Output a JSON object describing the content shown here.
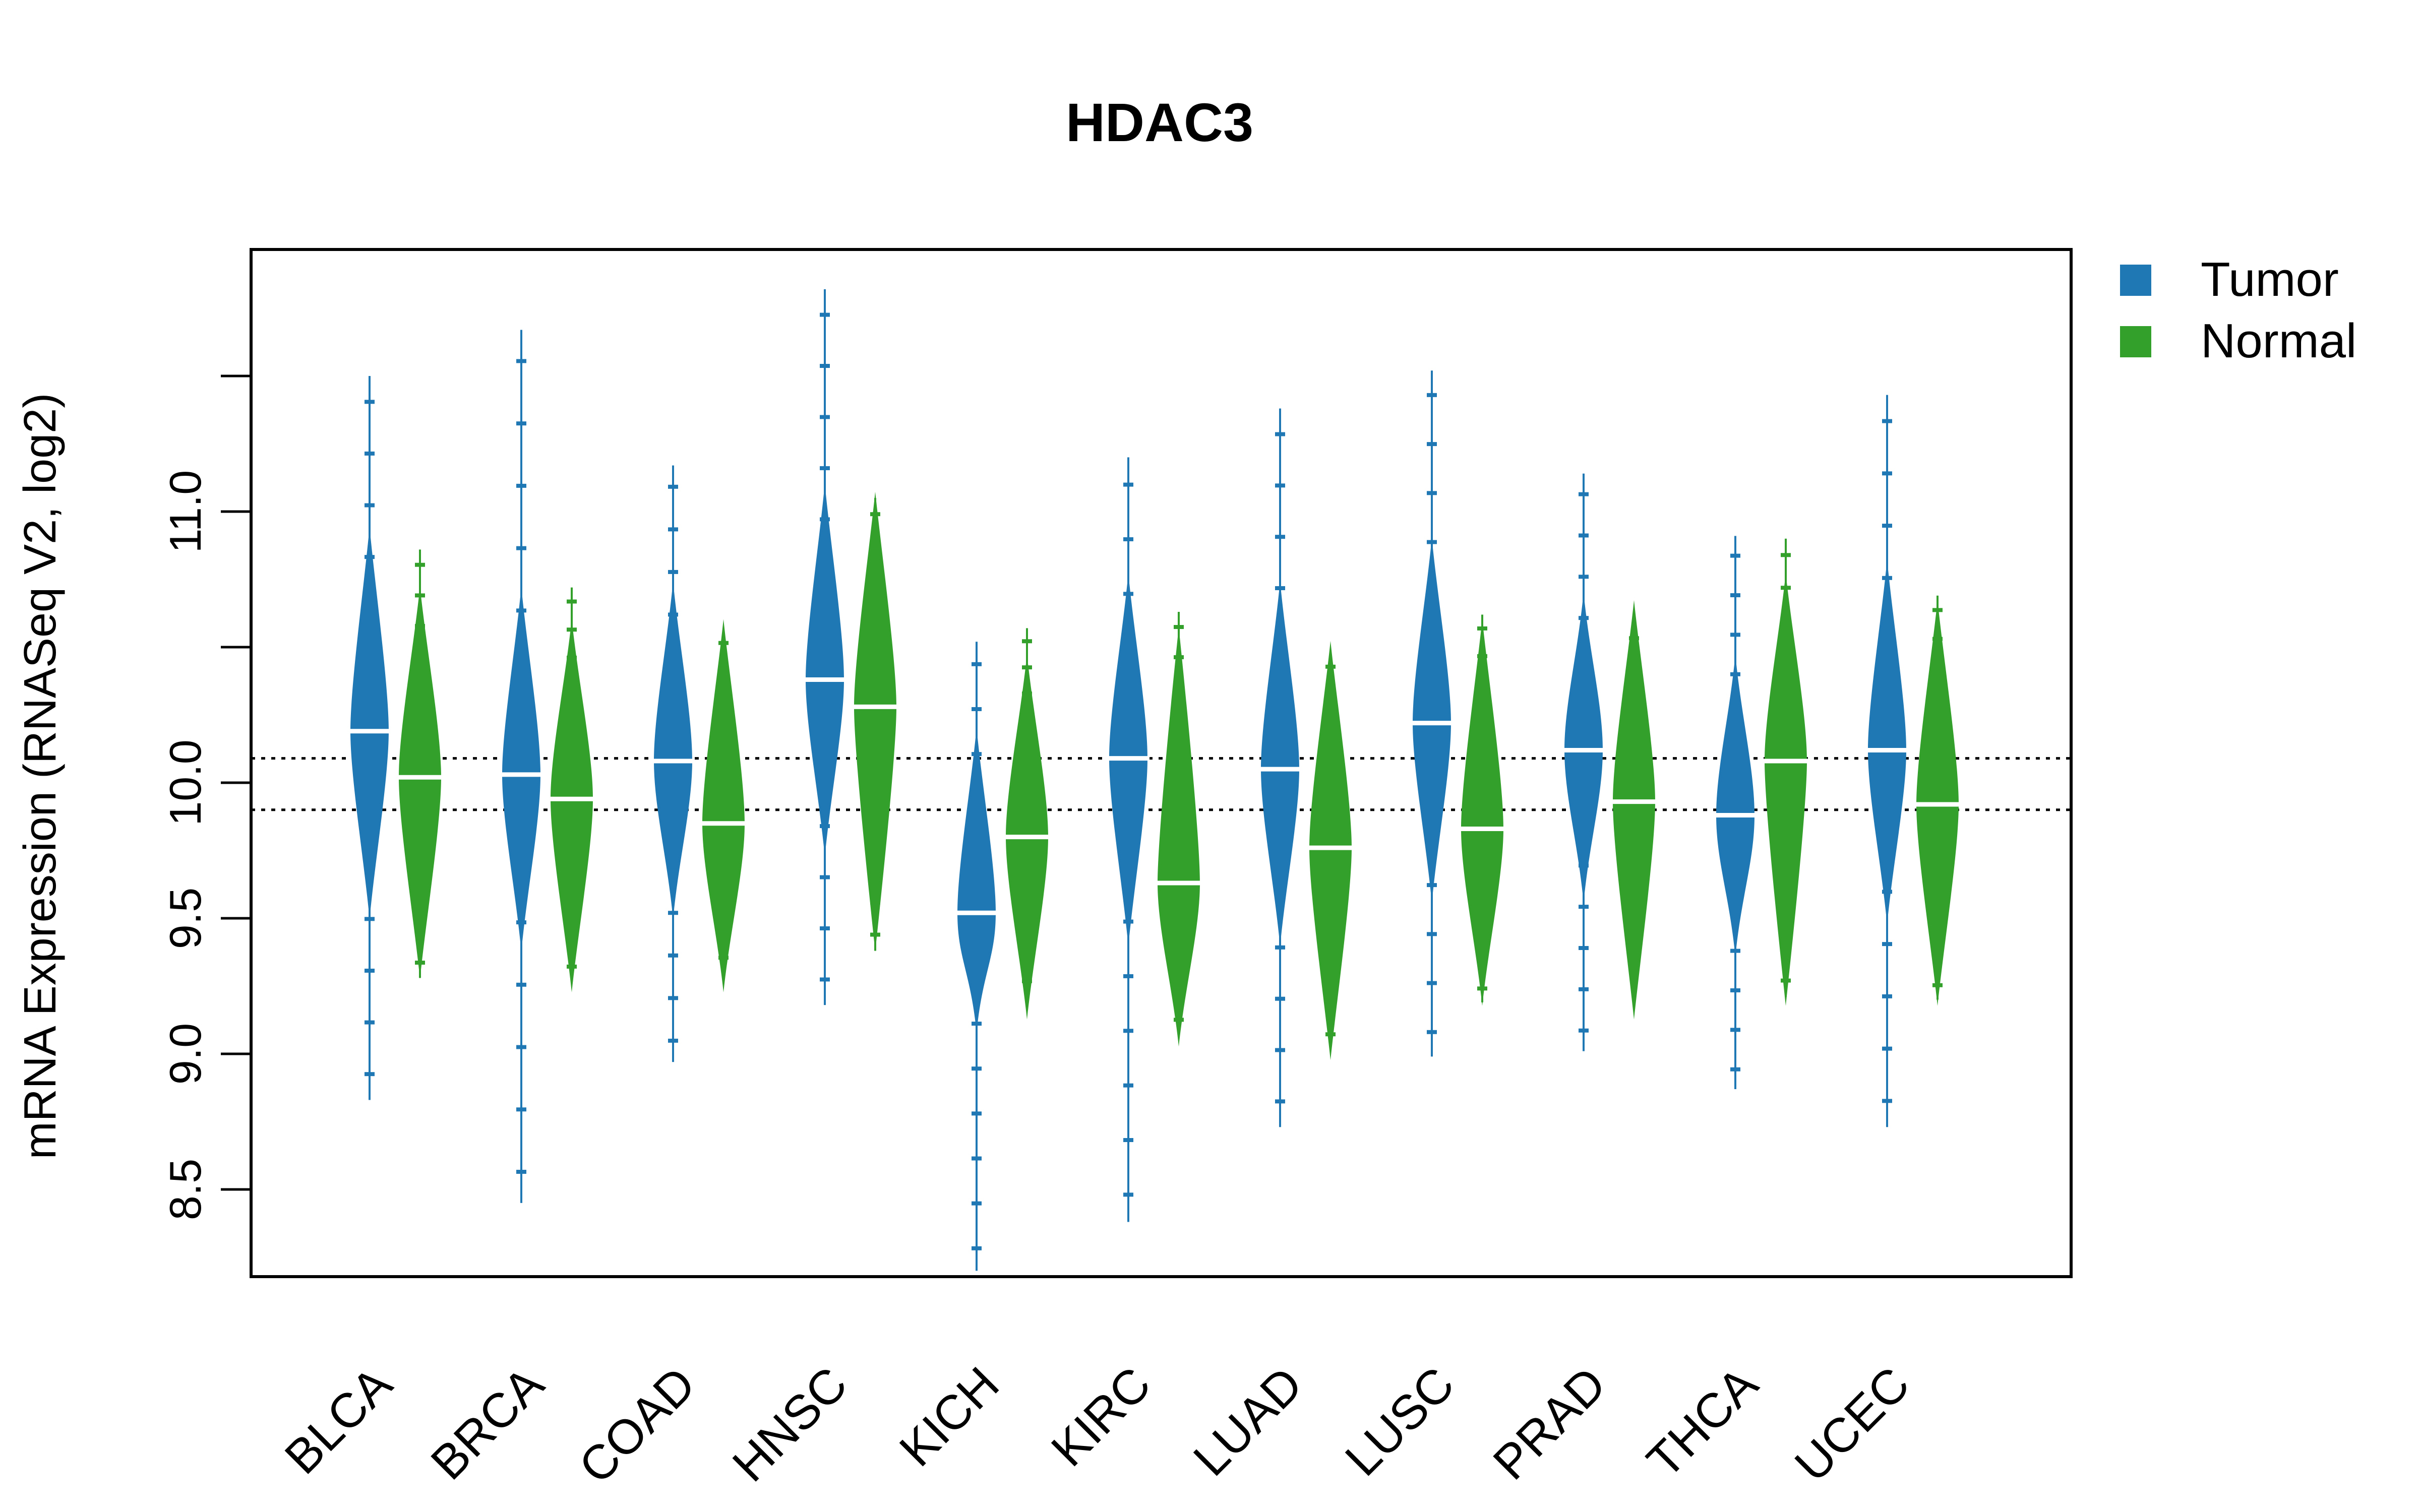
{
  "chart_data": {
    "type": "violin",
    "title": "HDAC3",
    "xlabel": "",
    "ylabel": "mRNA Expression (RNASeq V2, log2)",
    "ylim": [
      8.18,
      11.97
    ],
    "yticks": [
      8.5,
      9.0,
      9.5,
      10.0,
      10.5,
      11.0,
      11.5
    ],
    "ytick_labels": [
      "8.5",
      "9.0",
      "9.5",
      "10.0",
      "",
      "11.0",
      ""
    ],
    "hlines": [
      10.09,
      9.9
    ],
    "hline_style": "dotted",
    "legend": {
      "position": "top-right-outside",
      "entries": [
        {
          "name": "Tumor",
          "color": "#1f78b4"
        },
        {
          "name": "Normal",
          "color": "#33a02c"
        }
      ]
    },
    "categories": [
      "BLCA",
      "BRCA",
      "COAD",
      "HNSC",
      "KICH",
      "KIRC",
      "LUAD",
      "LUSC",
      "PRAD",
      "THCA",
      "UCEC"
    ],
    "series": [
      {
        "name": "Tumor",
        "color": "#1f78b4",
        "median": [
          10.19,
          10.03,
          10.08,
          10.38,
          9.52,
          10.09,
          10.05,
          10.22,
          10.12,
          9.88,
          10.12
        ],
        "min": [
          8.83,
          8.45,
          8.97,
          9.18,
          8.2,
          8.38,
          8.73,
          8.99,
          9.01,
          8.87,
          8.73
        ],
        "max": [
          11.5,
          11.67,
          11.17,
          11.82,
          10.52,
          11.2,
          11.38,
          11.52,
          11.14,
          10.91,
          11.43
        ],
        "q_low": [
          9.72,
          9.6,
          9.72,
          9.95,
          9.3,
          9.62,
          9.62,
          9.78,
          9.78,
          9.58,
          9.7
        ],
        "q_high": [
          10.72,
          10.5,
          10.52,
          10.88,
          9.98,
          10.55,
          10.52,
          10.68,
          10.48,
          10.25,
          10.6
        ]
      },
      {
        "name": "Normal",
        "color": "#33a02c",
        "median": [
          10.02,
          9.94,
          9.85,
          10.28,
          9.8,
          9.63,
          9.76,
          9.83,
          9.93,
          10.08,
          9.92
        ],
        "min": [
          9.28,
          9.27,
          9.31,
          9.38,
          9.22,
          9.07,
          9.02,
          9.19,
          9.26,
          9.21,
          9.2
        ],
        "max": [
          10.86,
          10.72,
          10.56,
          11.05,
          10.57,
          10.63,
          10.48,
          10.62,
          10.58,
          10.9,
          10.69
        ],
        "q_low": [
          9.5,
          9.45,
          9.45,
          9.6,
          9.35,
          9.25,
          9.2,
          9.4,
          9.35,
          9.4,
          9.4
        ],
        "q_high": [
          10.5,
          10.38,
          10.38,
          10.85,
          10.25,
          10.35,
          10.3,
          10.38,
          10.45,
          10.55,
          10.45
        ]
      }
    ]
  }
}
